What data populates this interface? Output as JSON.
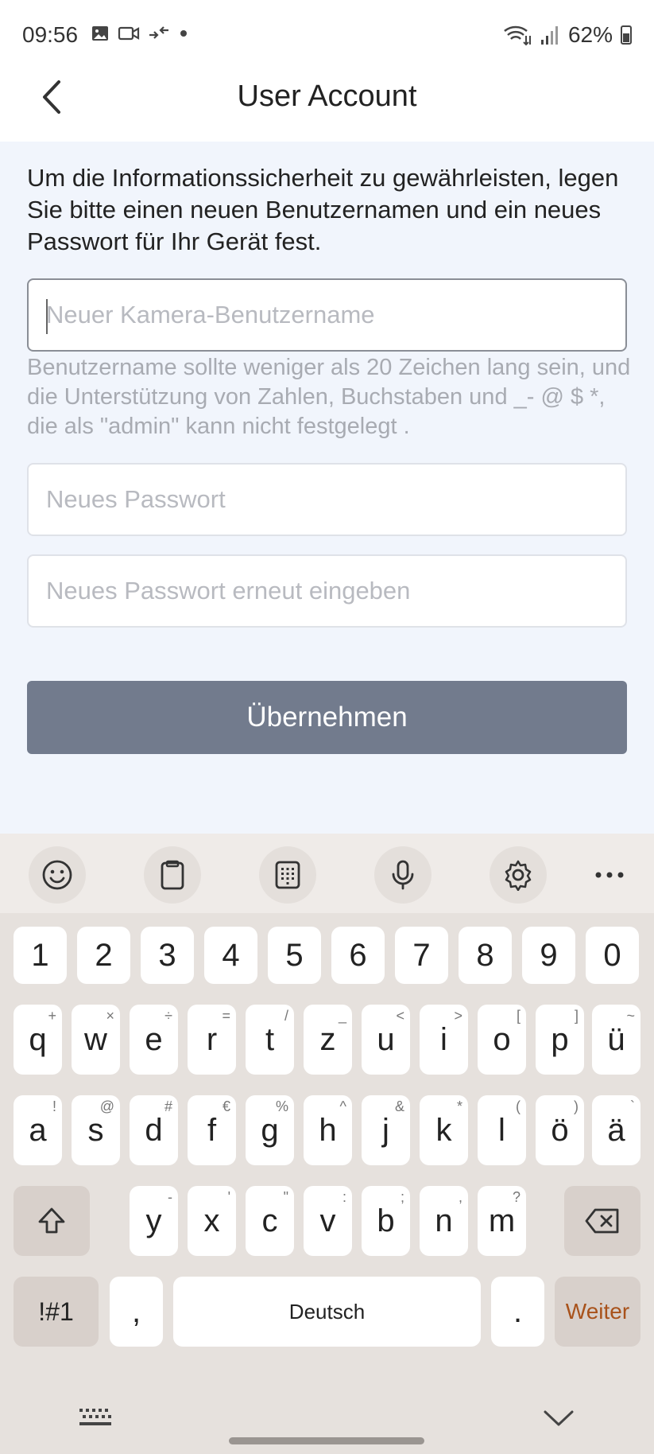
{
  "status_bar": {
    "time": "09:56",
    "battery": "62%"
  },
  "header": {
    "title": "User Account"
  },
  "form": {
    "intro": "Um die Informationssicherheit zu gewährleisten, legen Sie bitte einen neuen Benutzernamen und ein neues Passwort für Ihr Gerät fest.",
    "username_placeholder": "Neuer Kamera-Benutzername",
    "username_value": "",
    "username_hint": "Benutzername sollte weniger als 20 Zeichen lang sein, und die Unterstützung von Zahlen, Buchstaben und _- @ $ *, die als \"admin\" kann nicht festgelegt .",
    "password_placeholder": "Neues Passwort",
    "password_value": "",
    "confirm_placeholder": "Neues Passwort erneut eingeben",
    "confirm_value": "",
    "submit_label": "Übernehmen"
  },
  "keyboard": {
    "toolbar_icons": [
      "emoji-icon",
      "clipboard-icon",
      "keypad-icon",
      "microphone-icon",
      "gear-icon",
      "more-icon"
    ],
    "number_row": [
      "1",
      "2",
      "3",
      "4",
      "5",
      "6",
      "7",
      "8",
      "9",
      "0"
    ],
    "row1": [
      {
        "k": "q",
        "s": "+"
      },
      {
        "k": "w",
        "s": "×"
      },
      {
        "k": "e",
        "s": "÷"
      },
      {
        "k": "r",
        "s": "="
      },
      {
        "k": "t",
        "s": "/"
      },
      {
        "k": "z",
        "s": "_"
      },
      {
        "k": "u",
        "s": "<"
      },
      {
        "k": "i",
        "s": ">"
      },
      {
        "k": "o",
        "s": "["
      },
      {
        "k": "p",
        "s": "]"
      },
      {
        "k": "ü",
        "s": "~"
      }
    ],
    "row2": [
      {
        "k": "a",
        "s": "!"
      },
      {
        "k": "s",
        "s": "@"
      },
      {
        "k": "d",
        "s": "#"
      },
      {
        "k": "f",
        "s": "€"
      },
      {
        "k": "g",
        "s": "%"
      },
      {
        "k": "h",
        "s": "^"
      },
      {
        "k": "j",
        "s": "&"
      },
      {
        "k": "k",
        "s": "*"
      },
      {
        "k": "l",
        "s": "("
      },
      {
        "k": "ö",
        "s": ")"
      },
      {
        "k": "ä",
        "s": "`"
      }
    ],
    "row3": [
      {
        "k": "y",
        "s": "-"
      },
      {
        "k": "x",
        "s": "'"
      },
      {
        "k": "c",
        "s": "\""
      },
      {
        "k": "v",
        "s": ":"
      },
      {
        "k": "b",
        "s": ";"
      },
      {
        "k": "n",
        "s": ","
      },
      {
        "k": "m",
        "s": "?"
      }
    ],
    "symbols_label": "!#1",
    "comma_label": ",",
    "space_label": "Deutsch",
    "period_label": ".",
    "enter_label": "Weiter"
  },
  "colors": {
    "submit_bg": "#727b8d",
    "content_bg": "#f1f5fc",
    "enter_text": "#a8521b"
  }
}
